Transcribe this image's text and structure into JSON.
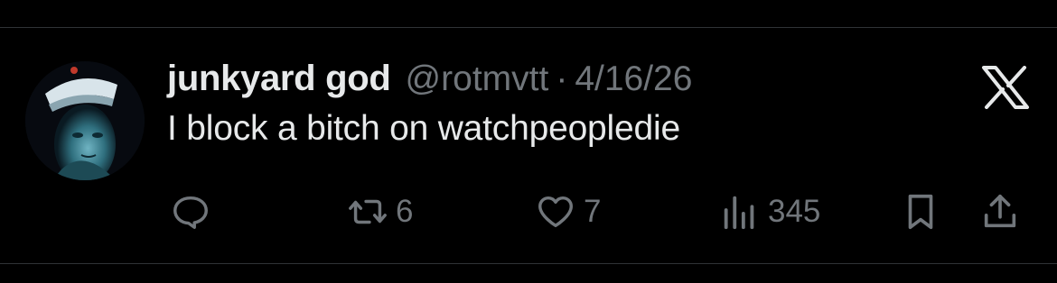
{
  "tweet": {
    "display_name": "junkyard god",
    "handle": "@rotmvtt",
    "separator": "·",
    "date": "4/16/26",
    "text": "I block a bitch on watchpeopledie"
  },
  "actions": {
    "reply_icon": "reply-bubble-icon",
    "retweet_icon": "retweet-icon",
    "retweet_count": "6",
    "like_icon": "heart-icon",
    "like_count": "7",
    "views_icon": "bar-chart-icon",
    "views_count": "345",
    "bookmark_icon": "bookmark-icon",
    "share_icon": "share-upload-icon"
  },
  "brand": {
    "logo_icon": "x-logo-icon"
  },
  "colors": {
    "background": "#000000",
    "primary_text": "#e7e9ea",
    "secondary_text": "#71767b",
    "divider": "#2f3336"
  }
}
